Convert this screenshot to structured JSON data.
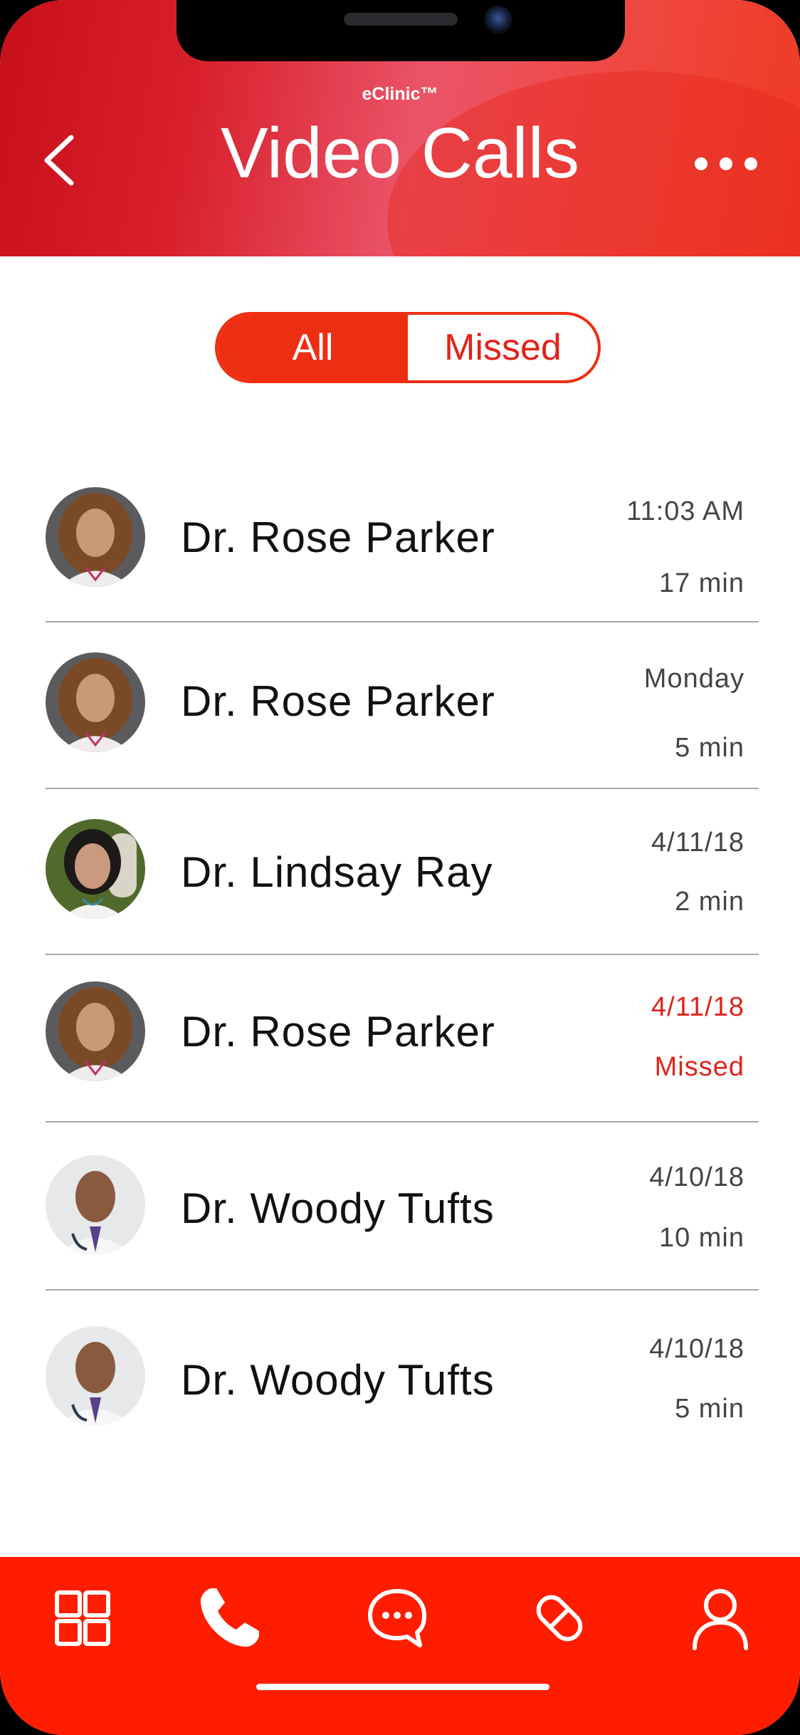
{
  "header": {
    "brand": "eClinic™",
    "title": "Video Calls",
    "back_icon": "chevron-left-icon",
    "more_icon": "more-horizontal-icon",
    "gradient_colors": [
      "#c8101a",
      "#ea5468",
      "#ee3a22"
    ]
  },
  "filter": {
    "options": [
      "All",
      "Missed"
    ],
    "selected": "All",
    "accent_color": "#ee2e12"
  },
  "calls": [
    {
      "name": "Dr. Rose Parker",
      "date": "11:03 AM",
      "duration": "17 min",
      "missed": false,
      "avatar": "rose-parker-avatar"
    },
    {
      "name": "Dr. Rose Parker",
      "date": "Monday",
      "duration": "5 min",
      "missed": false,
      "avatar": "rose-parker-avatar"
    },
    {
      "name": "Dr. Lindsay Ray",
      "date": "4/11/18",
      "duration": "2 min",
      "missed": false,
      "avatar": "lindsay-ray-avatar"
    },
    {
      "name": "Dr. Rose Parker",
      "date": "4/11/18",
      "duration": "Missed",
      "missed": true,
      "avatar": "rose-parker-avatar"
    },
    {
      "name": "Dr. Woody Tufts",
      "date": "4/10/18",
      "duration": "10 min",
      "missed": false,
      "avatar": "woody-tufts-avatar"
    },
    {
      "name": "Dr. Woody Tufts",
      "date": "4/10/18",
      "duration": "5 min",
      "missed": false,
      "avatar": "woody-tufts-avatar"
    }
  ],
  "tab_bar": {
    "background": "#ff1d00",
    "items": [
      {
        "icon": "grid-icon"
      },
      {
        "icon": "phone-icon"
      },
      {
        "icon": "chat-icon"
      },
      {
        "icon": "pill-icon"
      },
      {
        "icon": "user-icon"
      }
    ]
  },
  "colors": {
    "missed_text": "#e0231a",
    "text_primary": "#111111",
    "text_secondary": "#444444"
  }
}
